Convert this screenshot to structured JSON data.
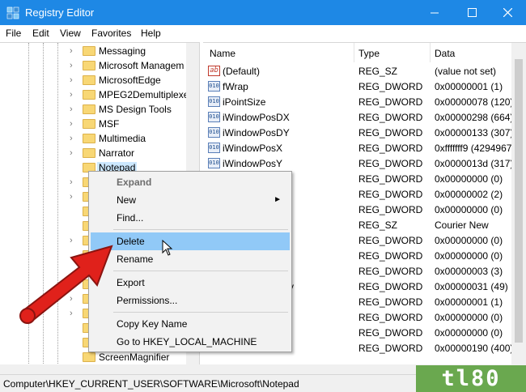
{
  "window": {
    "title": "Registry Editor"
  },
  "menu": [
    "File",
    "Edit",
    "View",
    "Favorites",
    "Help"
  ],
  "tree": [
    {
      "label": "Messaging",
      "expandable": true
    },
    {
      "label": "Microsoft Managem",
      "expandable": true
    },
    {
      "label": "MicrosoftEdge",
      "expandable": true
    },
    {
      "label": "MPEG2Demultiplexe",
      "expandable": true
    },
    {
      "label": "MS Design Tools",
      "expandable": true
    },
    {
      "label": "MSF",
      "expandable": true
    },
    {
      "label": "Multimedia",
      "expandable": true
    },
    {
      "label": "Narrator",
      "expandable": true
    },
    {
      "label": "Notepad",
      "expandable": false,
      "selected": true
    }
  ],
  "tree_partial_bottom": "ScreenMagnifier",
  "columns": {
    "name": "Name",
    "type": "Type",
    "data": "Data"
  },
  "values": [
    {
      "name": "(Default)",
      "type": "REG_SZ",
      "data": "(value not set)",
      "icon": "ab"
    },
    {
      "name": "fWrap",
      "type": "REG_DWORD",
      "data": "0x00000001 (1)",
      "icon": "010"
    },
    {
      "name": "iPointSize",
      "type": "REG_DWORD",
      "data": "0x00000078 (120)",
      "icon": "010"
    },
    {
      "name": "iWindowPosDX",
      "type": "REG_DWORD",
      "data": "0x00000298 (664)",
      "icon": "010"
    },
    {
      "name": "iWindowPosDY",
      "type": "REG_DWORD",
      "data": "0x00000133 (307)",
      "icon": "010"
    },
    {
      "name": "iWindowPosX",
      "type": "REG_DWORD",
      "data": "0xfffffff9 (4294967",
      "icon": "010"
    },
    {
      "name": "iWindowPosY",
      "type": "REG_DWORD",
      "data": "0x0000013d (317)",
      "icon": "010"
    },
    {
      "name": "",
      "type": "REG_DWORD",
      "data": "0x00000000 (0)",
      "icon": ""
    },
    {
      "name": "",
      "type": "REG_DWORD",
      "data": "0x00000002 (2)",
      "icon": ""
    },
    {
      "name": "",
      "type": "REG_DWORD",
      "data": "0x00000000 (0)",
      "icon": ""
    },
    {
      "name": "",
      "type": "REG_SZ",
      "data": "Courier New",
      "icon": ""
    },
    {
      "name": "",
      "type": "REG_DWORD",
      "data": "0x00000000 (0)",
      "icon": ""
    },
    {
      "name": "",
      "type": "REG_DWORD",
      "data": "0x00000000 (0)",
      "icon": ""
    },
    {
      "name": "",
      "type": "REG_DWORD",
      "data": "0x00000003 (3)",
      "icon": ""
    },
    {
      "name": "y",
      "type": "REG_DWORD",
      "data": "0x00000031 (49)",
      "icon": ""
    },
    {
      "name": "",
      "type": "REG_DWORD",
      "data": "0x00000001 (1)",
      "icon": ""
    },
    {
      "name": "",
      "type": "REG_DWORD",
      "data": "0x00000000 (0)",
      "icon": ""
    },
    {
      "name": "",
      "type": "REG_DWORD",
      "data": "0x00000000 (0)",
      "icon": ""
    },
    {
      "name": "",
      "type": "REG_DWORD",
      "data": "0x00000190 (400)",
      "icon": ""
    }
  ],
  "context_menu": {
    "expand": "Expand",
    "new": "New",
    "find": "Find...",
    "delete": "Delete",
    "rename": "Rename",
    "export": "Export",
    "permissions": "Permissions...",
    "copy_key_name": "Copy Key Name",
    "goto_hklm": "Go to HKEY_LOCAL_MACHINE"
  },
  "status": "Computer\\HKEY_CURRENT_USER\\SOFTWARE\\Microsoft\\Notepad",
  "watermark": "tl80",
  "colors": {
    "titlebar": "#1e88e5",
    "hover": "#91c9f7",
    "arrow": "#e0211b"
  }
}
